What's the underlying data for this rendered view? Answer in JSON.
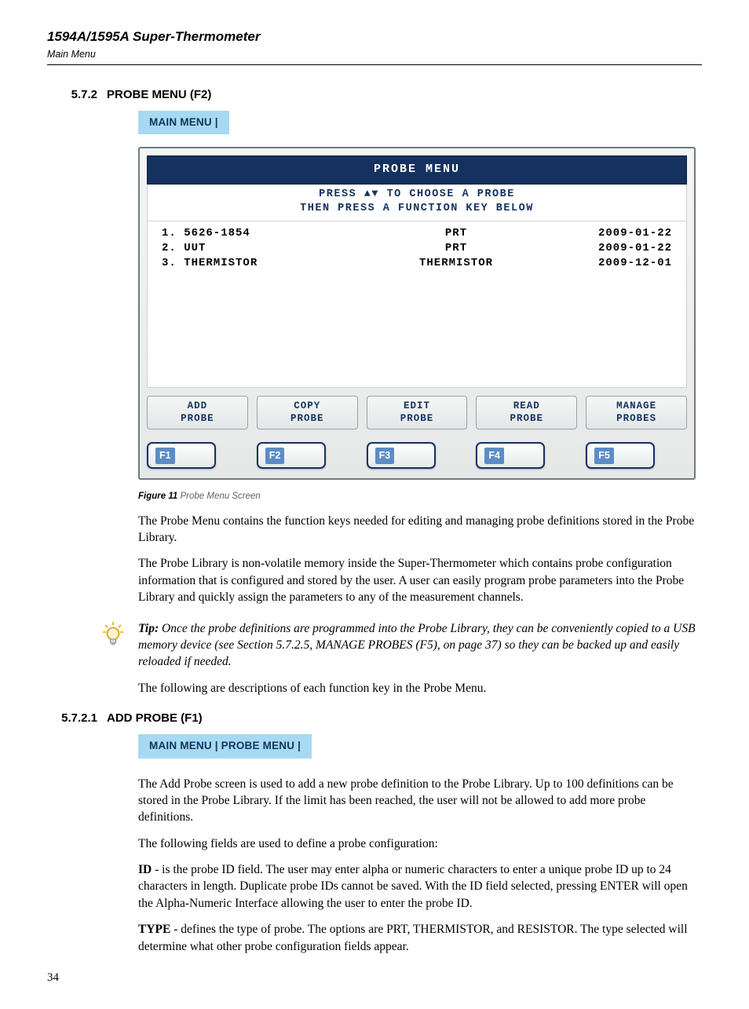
{
  "header": {
    "product": "1594A/1595A Super-Thermometer",
    "sub": "Main Menu"
  },
  "section1": {
    "number": "5.7.2",
    "title": "PROBE MENU (F2)",
    "breadcrumb": "MAIN MENU |"
  },
  "screen": {
    "title": "PROBE  MENU",
    "instr_line1": "PRESS ▲▼ TO CHOOSE A PROBE",
    "instr_line2": "THEN PRESS A FUNCTION KEY BELOW",
    "rows": [
      {
        "c1": "1. 5626-1854",
        "c2": "PRT",
        "c3": "2009-01-22"
      },
      {
        "c1": "2. UUT",
        "c2": "PRT",
        "c3": "2009-01-22"
      },
      {
        "c1": "3. THERMISTOR",
        "c2": "THERMISTOR",
        "c3": "2009-12-01"
      }
    ],
    "softkeys": [
      {
        "line1": "ADD",
        "line2": "PROBE"
      },
      {
        "line1": "COPY",
        "line2": "PROBE"
      },
      {
        "line1": "EDIT",
        "line2": "PROBE"
      },
      {
        "line1": "READ",
        "line2": "PROBE"
      },
      {
        "line1": "MANAGE",
        "line2": "PROBES"
      }
    ],
    "fkeys": [
      "F1",
      "F2",
      "F3",
      "F4",
      "F5"
    ]
  },
  "figure": {
    "label": "Figure 11",
    "caption": " Probe Menu Screen"
  },
  "para1": "The Probe Menu contains the function keys needed for editing and managing probe definitions stored in the Probe Library.",
  "para2": "The Probe Library is non-volatile memory inside the Super-Thermometer which contains probe configuration information that is configured and stored by the user. A user can easily program probe parameters into the Probe Library and quickly assign the parameters to any of the measurement channels.",
  "tip": {
    "label": "Tip:",
    "text": " Once the probe definitions are programmed into the Probe Library, they can be conveniently copied to a USB memory device (see Section 5.7.2.5, MANAGE PROBES (F5), on page 37) so they can be backed up and easily reloaded if needed."
  },
  "para3": "The following are descriptions of each function key in the Probe Menu.",
  "section2": {
    "number": "5.7.2.1",
    "title": "ADD PROBE (F1)",
    "breadcrumb": "MAIN MENU | PROBE MENU |"
  },
  "para4": "The Add Probe screen is used to add a new probe definition to the Probe Library. Up to 100 definitions can be stored in the Probe Library. If the limit has been reached, the user will not be allowed to add more probe definitions.",
  "para5": "The following fields are used to define a probe configuration:",
  "fields": {
    "id_label": "ID",
    "id_text": " - is the probe ID field. The user may enter alpha or numeric characters to enter a unique probe ID up to 24 characters in length. Duplicate probe IDs cannot be saved. With the ID field selected, pressing ENTER will open the Alpha-Numeric Interface allowing the user to enter the probe ID.",
    "type_label": "TYPE",
    "type_text": " - defines the type of probe. The options are PRT, THERMISTOR, and RESISTOR. The type selected will determine what other probe configuration fields appear."
  },
  "page_number": "34"
}
